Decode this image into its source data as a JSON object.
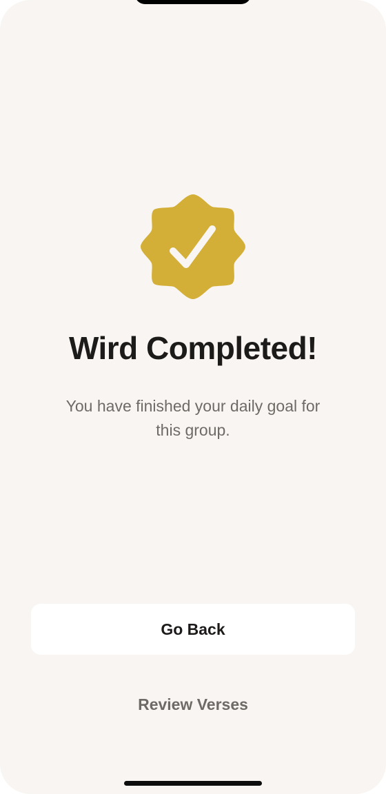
{
  "screen": {
    "title": "Wird Completed!",
    "subtitle": "You have finished your daily goal for this group.",
    "badge_icon": "verified-check-badge-icon",
    "badge_color": "#D4AF37"
  },
  "actions": {
    "primary_label": "Go Back",
    "secondary_label": "Review Verses"
  },
  "colors": {
    "background": "#F8F5F2",
    "title_text": "#1C1B1A",
    "muted_text": "#6E6B67",
    "button_background": "#FFFFFF"
  }
}
